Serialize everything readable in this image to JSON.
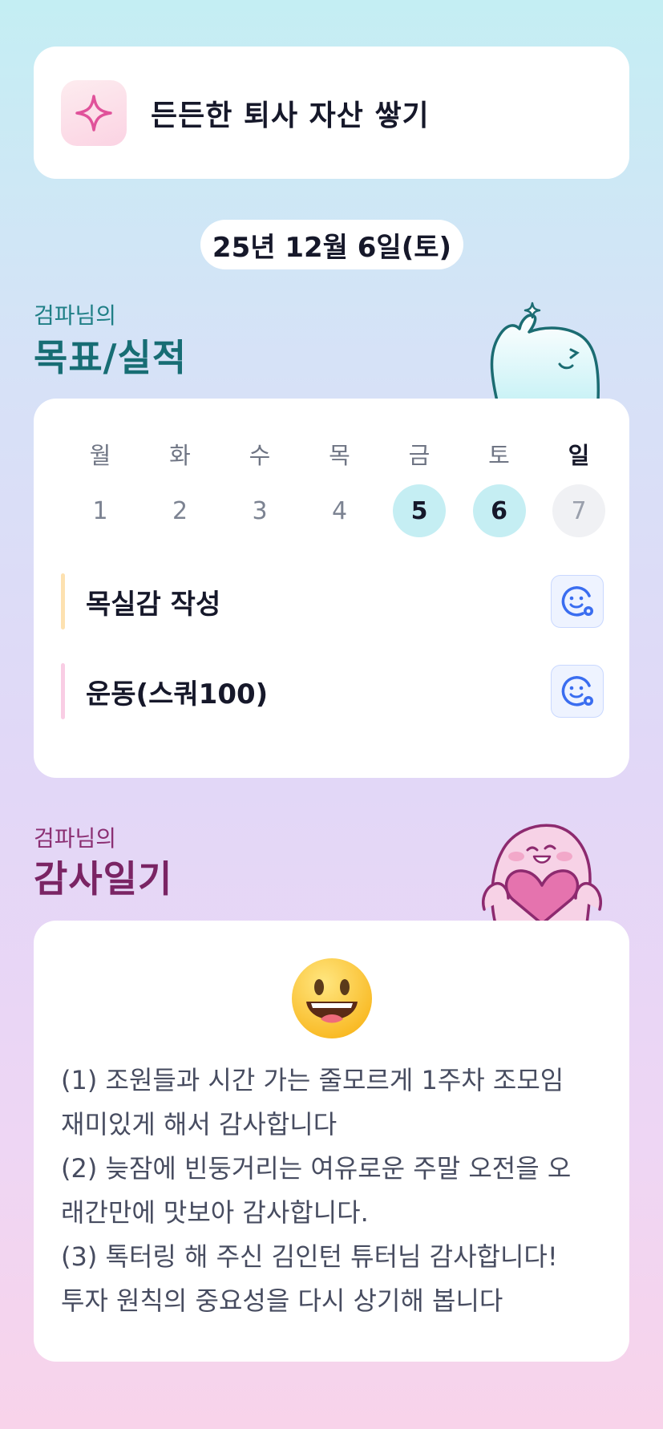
{
  "goal": {
    "title": "든든한 퇴사 자산 쌓기",
    "icon": "sparkle-icon"
  },
  "date": "25년 12월 6일(토)",
  "goals_section": {
    "owner": "검파님의",
    "title": "목표/실적"
  },
  "week": {
    "days": [
      "월",
      "화",
      "수",
      "목",
      "금",
      "토",
      "일"
    ],
    "dates": [
      "1",
      "2",
      "3",
      "4",
      "5",
      "6",
      "7"
    ]
  },
  "tasks": [
    {
      "label": "목실감 작성",
      "bar_color": "#fde1b0"
    },
    {
      "label": "운동(스쿼100)",
      "bar_color": "#f9cde4"
    }
  ],
  "diary_section": {
    "owner": "검파님의",
    "title": "감사일기"
  },
  "diary": {
    "emoji": "grinning-face",
    "text": "(1) 조원들과 시간 가는 줄모르게 1주차 조모임\n재미있게 해서 감사합니다\n(2) 늦잠에 빈둥거리는 여유로운 주말 오전을 오\n래간만에 맛보아 감사합니다.\n(3) 톡터링 해 주신 김인턴 튜터님 감사합니다!\n투자 원칙의 중요성을 다시 상기해 봅니다"
  },
  "colors": {
    "accent_teal": "#1f7f86",
    "accent_purple": "#8b2f73",
    "active_date": "#c5eef3",
    "today_date": "#f0f1f4"
  }
}
